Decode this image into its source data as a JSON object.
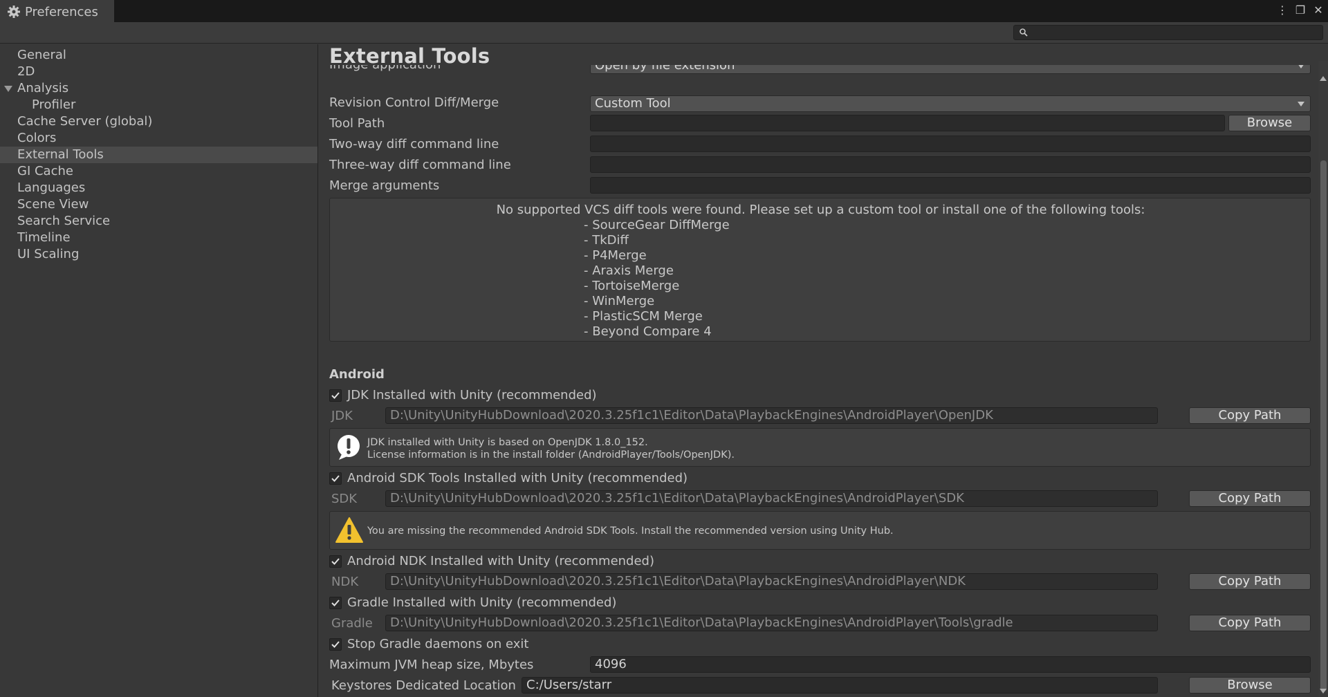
{
  "window": {
    "tab_title": "Preferences",
    "controls": [
      "⋮",
      "❐",
      "✕"
    ]
  },
  "search": {
    "value": ""
  },
  "sidebar": {
    "items": [
      {
        "label": "General"
      },
      {
        "label": "2D"
      },
      {
        "label": "Analysis",
        "expanded": true
      },
      {
        "label": "Profiler",
        "child": true
      },
      {
        "label": "Cache Server (global)"
      },
      {
        "label": "Colors"
      },
      {
        "label": "External Tools",
        "selected": true
      },
      {
        "label": "GI Cache"
      },
      {
        "label": "Languages"
      },
      {
        "label": "Scene View"
      },
      {
        "label": "Search Service"
      },
      {
        "label": "Timeline"
      },
      {
        "label": "UI Scaling"
      }
    ]
  },
  "main": {
    "title": "External Tools",
    "image_application": {
      "label": "Image application",
      "value": "Open by file extension"
    },
    "revision_control": {
      "label": "Revision Control Diff/Merge",
      "value": "Custom Tool"
    },
    "tool_path": {
      "label": "Tool Path",
      "value": "",
      "button": "Browse"
    },
    "two_way": {
      "label": "Two-way diff command line",
      "value": ""
    },
    "three_way": {
      "label": "Three-way diff command line",
      "value": ""
    },
    "merge_args": {
      "label": "Merge arguments",
      "value": ""
    },
    "vcs_help": {
      "header": "No supported VCS diff tools were found. Please set up a custom tool or install one of the following tools:",
      "tools": [
        "- SourceGear DiffMerge",
        "- TkDiff",
        "- P4Merge",
        "- Araxis Merge",
        "- TortoiseMerge",
        "- WinMerge",
        "- PlasticSCM Merge",
        "- Beyond Compare 4"
      ]
    },
    "android": {
      "header": "Android",
      "jdk_toggle": {
        "label": "JDK Installed with Unity (recommended)",
        "checked": true
      },
      "jdk": {
        "label": "JDK",
        "path": "D:\\Unity\\UnityHubDownload\\2020.3.25f1c1\\Editor\\Data\\PlaybackEngines\\AndroidPlayer\\OpenJDK",
        "button": "Copy Path"
      },
      "jdk_info": {
        "line1": "JDK installed with Unity is based on OpenJDK 1.8.0_152.",
        "line2": "License information is in the install folder (AndroidPlayer/Tools/OpenJDK)."
      },
      "sdk_toggle": {
        "label": "Android SDK Tools Installed with Unity (recommended)",
        "checked": true
      },
      "sdk": {
        "label": "SDK",
        "path": "D:\\Unity\\UnityHubDownload\\2020.3.25f1c1\\Editor\\Data\\PlaybackEngines\\AndroidPlayer\\SDK",
        "button": "Copy Path"
      },
      "sdk_warning": "You are missing the recommended Android SDK Tools. Install the recommended version using Unity Hub.",
      "ndk_toggle": {
        "label": "Android NDK Installed with Unity (recommended)",
        "checked": true
      },
      "ndk": {
        "label": "NDK",
        "path": "D:\\Unity\\UnityHubDownload\\2020.3.25f1c1\\Editor\\Data\\PlaybackEngines\\AndroidPlayer\\NDK",
        "button": "Copy Path"
      },
      "gradle_toggle": {
        "label": "Gradle Installed with Unity (recommended)",
        "checked": true
      },
      "gradle": {
        "label": "Gradle",
        "path": "D:\\Unity\\UnityHubDownload\\2020.3.25f1c1\\Editor\\Data\\PlaybackEngines\\AndroidPlayer\\Tools\\gradle",
        "button": "Copy Path"
      },
      "stop_gradle": {
        "label": "Stop Gradle daemons on exit",
        "checked": true
      },
      "jvm_heap": {
        "label": "Maximum JVM heap size, Mbytes",
        "value": "4096"
      },
      "keystores": {
        "label": "Keystores Dedicated Location",
        "value": "C:/Users/starr",
        "button": "Browse"
      }
    }
  },
  "colors": {
    "background": "#383838",
    "titlebar": "#191919",
    "selected_item": "#4a4a4a",
    "info_icon": "#ffffff",
    "warning_icon": "#f2c12e"
  },
  "icons": {
    "tab": "gear-icon",
    "search": "search-icon",
    "info": "info-icon",
    "warning": "warning-icon",
    "checkbox": "checkmark-icon"
  }
}
